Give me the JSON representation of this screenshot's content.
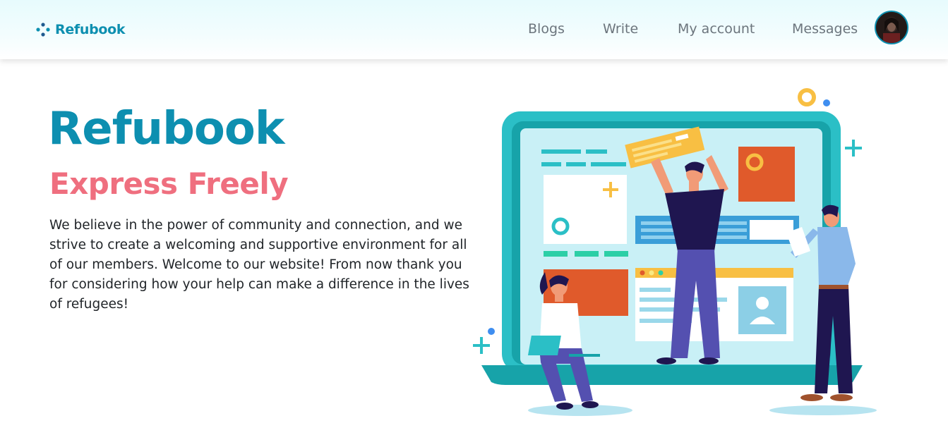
{
  "navbar": {
    "brand": "Refubook",
    "links": [
      "Blogs",
      "Write",
      "My account",
      "Messages"
    ]
  },
  "hero": {
    "title": "Refubook",
    "subtitle": "Express Freely",
    "description": "We believe in the power of community and connection, and we strive to create a welcoming and supportive environment for all of our members. Welcome to our website! From now thank you for considering how your help can make a difference in the lives of refugees!"
  },
  "icons": {
    "brand": "dots-logo-icon",
    "avatar": "user-avatar"
  },
  "colors": {
    "brand": "#0d8fb0",
    "accent": "#ef6f7f",
    "nav_text": "#6c757d",
    "body_text": "#212529",
    "teal": "#2bbfc6",
    "orange": "#e05a2b",
    "yellow": "#f8bf43",
    "navy": "#1f1650"
  }
}
